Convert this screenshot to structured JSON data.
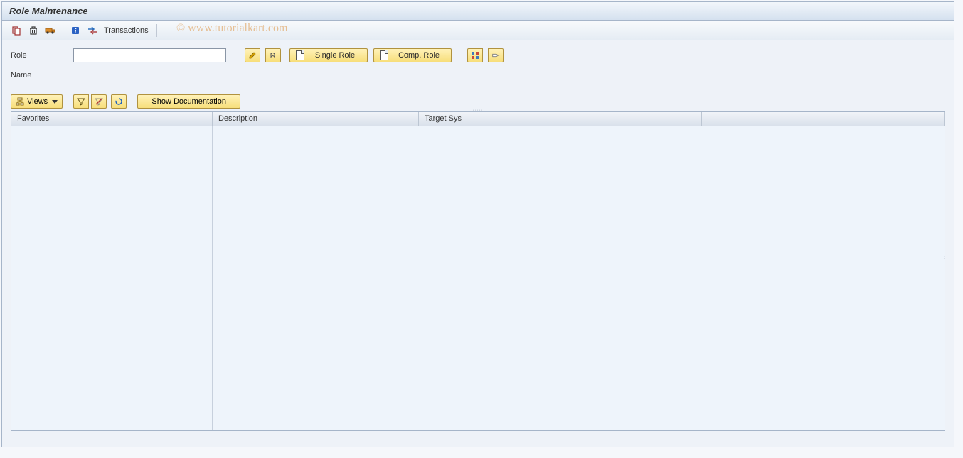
{
  "title": "Role Maintenance",
  "watermark": "© www.tutorialkart.com",
  "toolbar": {
    "transactions_label": "Transactions"
  },
  "form": {
    "role_label": "Role",
    "role_value": "",
    "name_label": "Name",
    "single_role_label": "Single Role",
    "comp_role_label": "Comp. Role"
  },
  "views_bar": {
    "views_label": "Views",
    "show_doc_label": "Show Documentation"
  },
  "table": {
    "col_favorites": "Favorites",
    "col_description": "Description",
    "col_target_sys": "Target Sys"
  }
}
